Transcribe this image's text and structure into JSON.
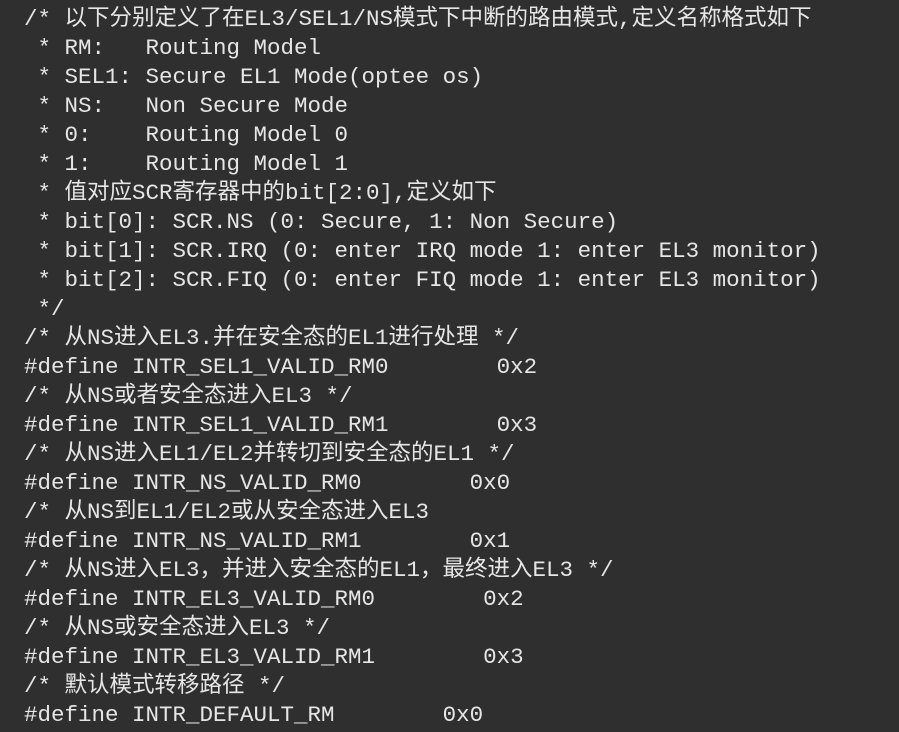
{
  "editor": {
    "lines": [
      "/* 以下分别定义了在EL3/SEL1/NS模式下中断的路由模式,定义名称格式如下",
      " * RM:   Routing Model",
      " * SEL1: Secure EL1 Mode(optee os)",
      " * NS:   Non Secure Mode",
      " * 0:    Routing Model 0",
      " * 1:    Routing Model 1",
      " * 值对应SCR寄存器中的bit[2:0],定义如下",
      " * bit[0]: SCR.NS (0: Secure, 1: Non Secure)",
      " * bit[1]: SCR.IRQ (0: enter IRQ mode 1: enter EL3 monitor)",
      " * bit[2]: SCR.FIQ (0: enter FIQ mode 1: enter EL3 monitor)",
      " */",
      "/* 从NS进入EL3.并在安全态的EL1进行处理 */",
      "#define INTR_SEL1_VALID_RM0        0x2",
      "/* 从NS或者安全态进入EL3 */",
      "#define INTR_SEL1_VALID_RM1        0x3",
      "/* 从NS进入EL1/EL2并转切到安全态的EL1 */",
      "#define INTR_NS_VALID_RM0        0x0",
      "/* 从NS到EL1/EL2或从安全态进入EL3",
      "#define INTR_NS_VALID_RM1        0x1",
      "/* 从NS进入EL3，并进入安全态的EL1，最终进入EL3 */",
      "#define INTR_EL3_VALID_RM0        0x2",
      "/* 从NS或安全态进入EL3 */",
      "#define INTR_EL3_VALID_RM1        0x3",
      "/* 默认模式转移路径 */",
      "#define INTR_DEFAULT_RM        0x0"
    ]
  }
}
